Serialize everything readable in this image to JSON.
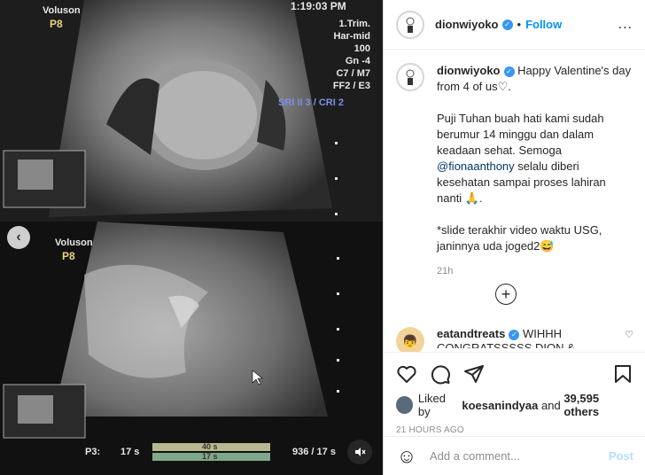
{
  "media": {
    "machine_top": "Voluson",
    "model_top": "P8",
    "clock": "1:19:03 PM",
    "settings": [
      "1.Trim.",
      "Har-mid",
      "100",
      "Gn -4",
      "C7 / M7",
      "FF2 / E3"
    ],
    "sri": "SRI II 3 / CRI 2",
    "machine_bottom": "Voluson",
    "model_bottom": "P8",
    "bottom_p3": "P3:",
    "bottom_17s": "17 s",
    "bottom_bar_top": "40 s",
    "bottom_bar_bot": "17 s",
    "bottom_right": "936 / 17 s",
    "prev_icon": "chevron-left-icon",
    "mute_icon": "mute-icon"
  },
  "header": {
    "username": "dionwiyoko",
    "separator": "•",
    "follow_label": "Follow",
    "more_label": "..."
  },
  "caption": {
    "username": "dionwiyoko",
    "line1": "Happy Valentine's day from 4 of us♡.",
    "para2": "Puji Tuhan buah hati kami sudah berumur 14 minggu dan dalam keadaan sehat. Semoga",
    "mention": "@fionaanthony",
    "para2b": "selalu diberi kesehatan sampai proses lahiran nanti 🙏.",
    "para3": "*slide terakhir video waktu USG, janinnya uda joged2😅",
    "time": "21h"
  },
  "comment": {
    "username": "eatandtreats",
    "text": "WIHHH CONGRATSSSSS DION & FIONA"
  },
  "actions": {
    "liked_by_prefix": "Liked by",
    "liked_user": "koesanindyaa",
    "and": "and",
    "count": "39,595 others",
    "ago": "21 HOURS AGO"
  },
  "add_comment": {
    "placeholder": "Add a comment...",
    "post_label": "Post"
  },
  "colors": {
    "accent": "#0095f6",
    "verified": "#3897f0",
    "post_disabled": "#b2dffc"
  }
}
